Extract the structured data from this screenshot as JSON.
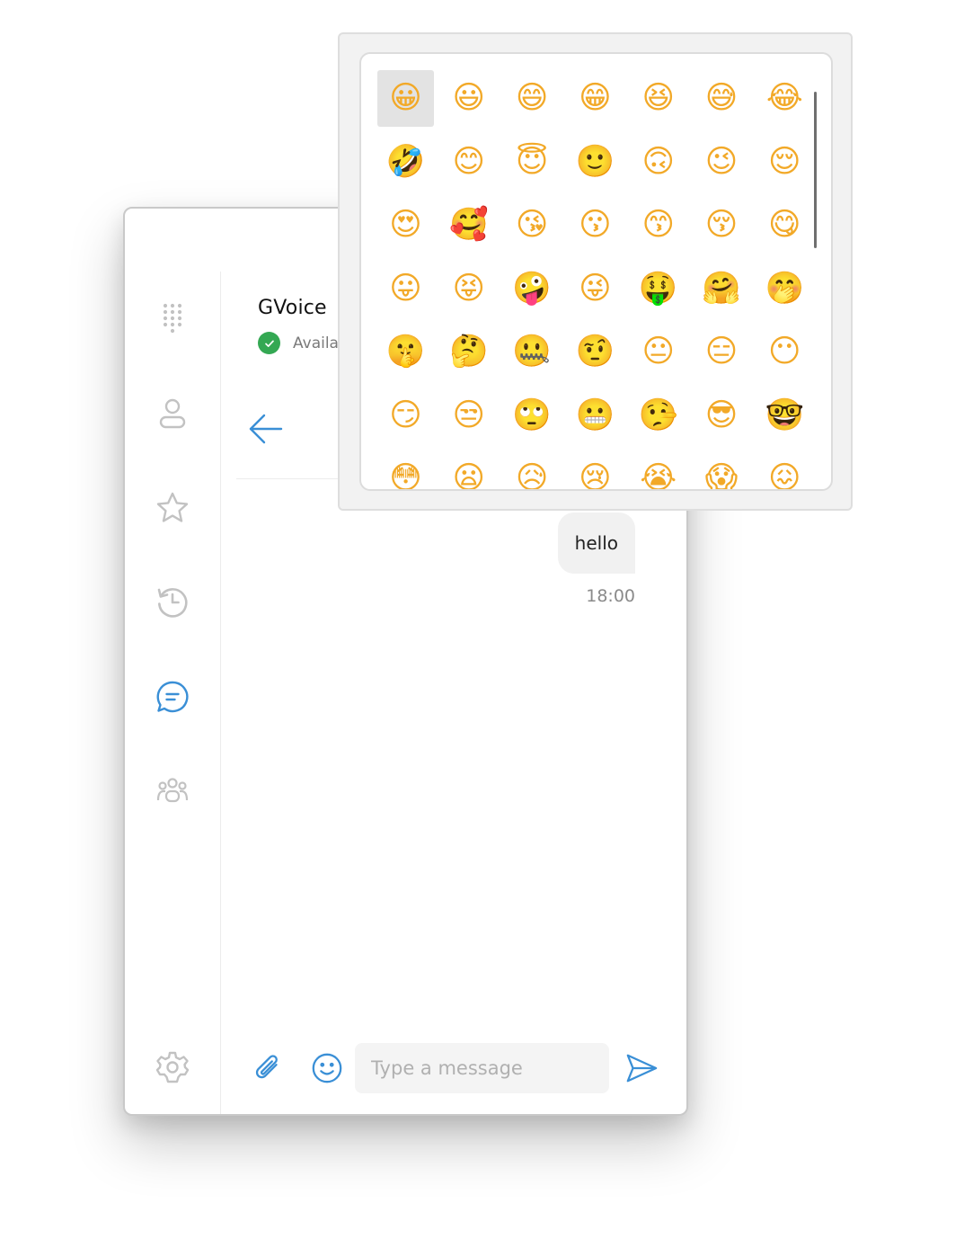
{
  "contact": {
    "name": "GVoice",
    "status": "Availa",
    "status_color": "#34a853"
  },
  "messages": [
    {
      "text": "hello",
      "time": "18:00",
      "direction": "outgoing"
    }
  ],
  "composer": {
    "placeholder": "Type a message"
  },
  "sidebar": {
    "items": [
      {
        "icon": "dialpad-icon",
        "active": false
      },
      {
        "icon": "contact-icon",
        "active": false
      },
      {
        "icon": "star-icon",
        "active": false
      },
      {
        "icon": "history-icon",
        "active": false
      },
      {
        "icon": "chat-icon",
        "active": true
      },
      {
        "icon": "group-icon",
        "active": false
      },
      {
        "icon": "gear-icon",
        "active": false
      }
    ]
  },
  "colors": {
    "accent": "#3a8fd6",
    "icon_inactive": "#c2c2c2",
    "bubble": "#f1f1f1"
  },
  "emoji_picker": {
    "selected_index": 0,
    "emojis": [
      "😀",
      "😃",
      "😄",
      "😁",
      "😆",
      "😅",
      "😂",
      "🤣",
      "😊",
      "😇",
      "🙂",
      "🙃",
      "😉",
      "😌",
      "😍",
      "🥰",
      "😘",
      "😗",
      "😙",
      "😚",
      "😋",
      "😛",
      "😝",
      "🤪",
      "😜",
      "🤑",
      "🤗",
      "🤭",
      "🤫",
      "🤔",
      "🤐",
      "🤨",
      "😐",
      "😑",
      "😶",
      "😏",
      "😒",
      "🙄",
      "😬",
      "🤥",
      "😎",
      "🤓",
      "😳",
      "😦",
      "😥",
      "😢",
      "😭",
      "😱",
      "😖"
    ]
  }
}
